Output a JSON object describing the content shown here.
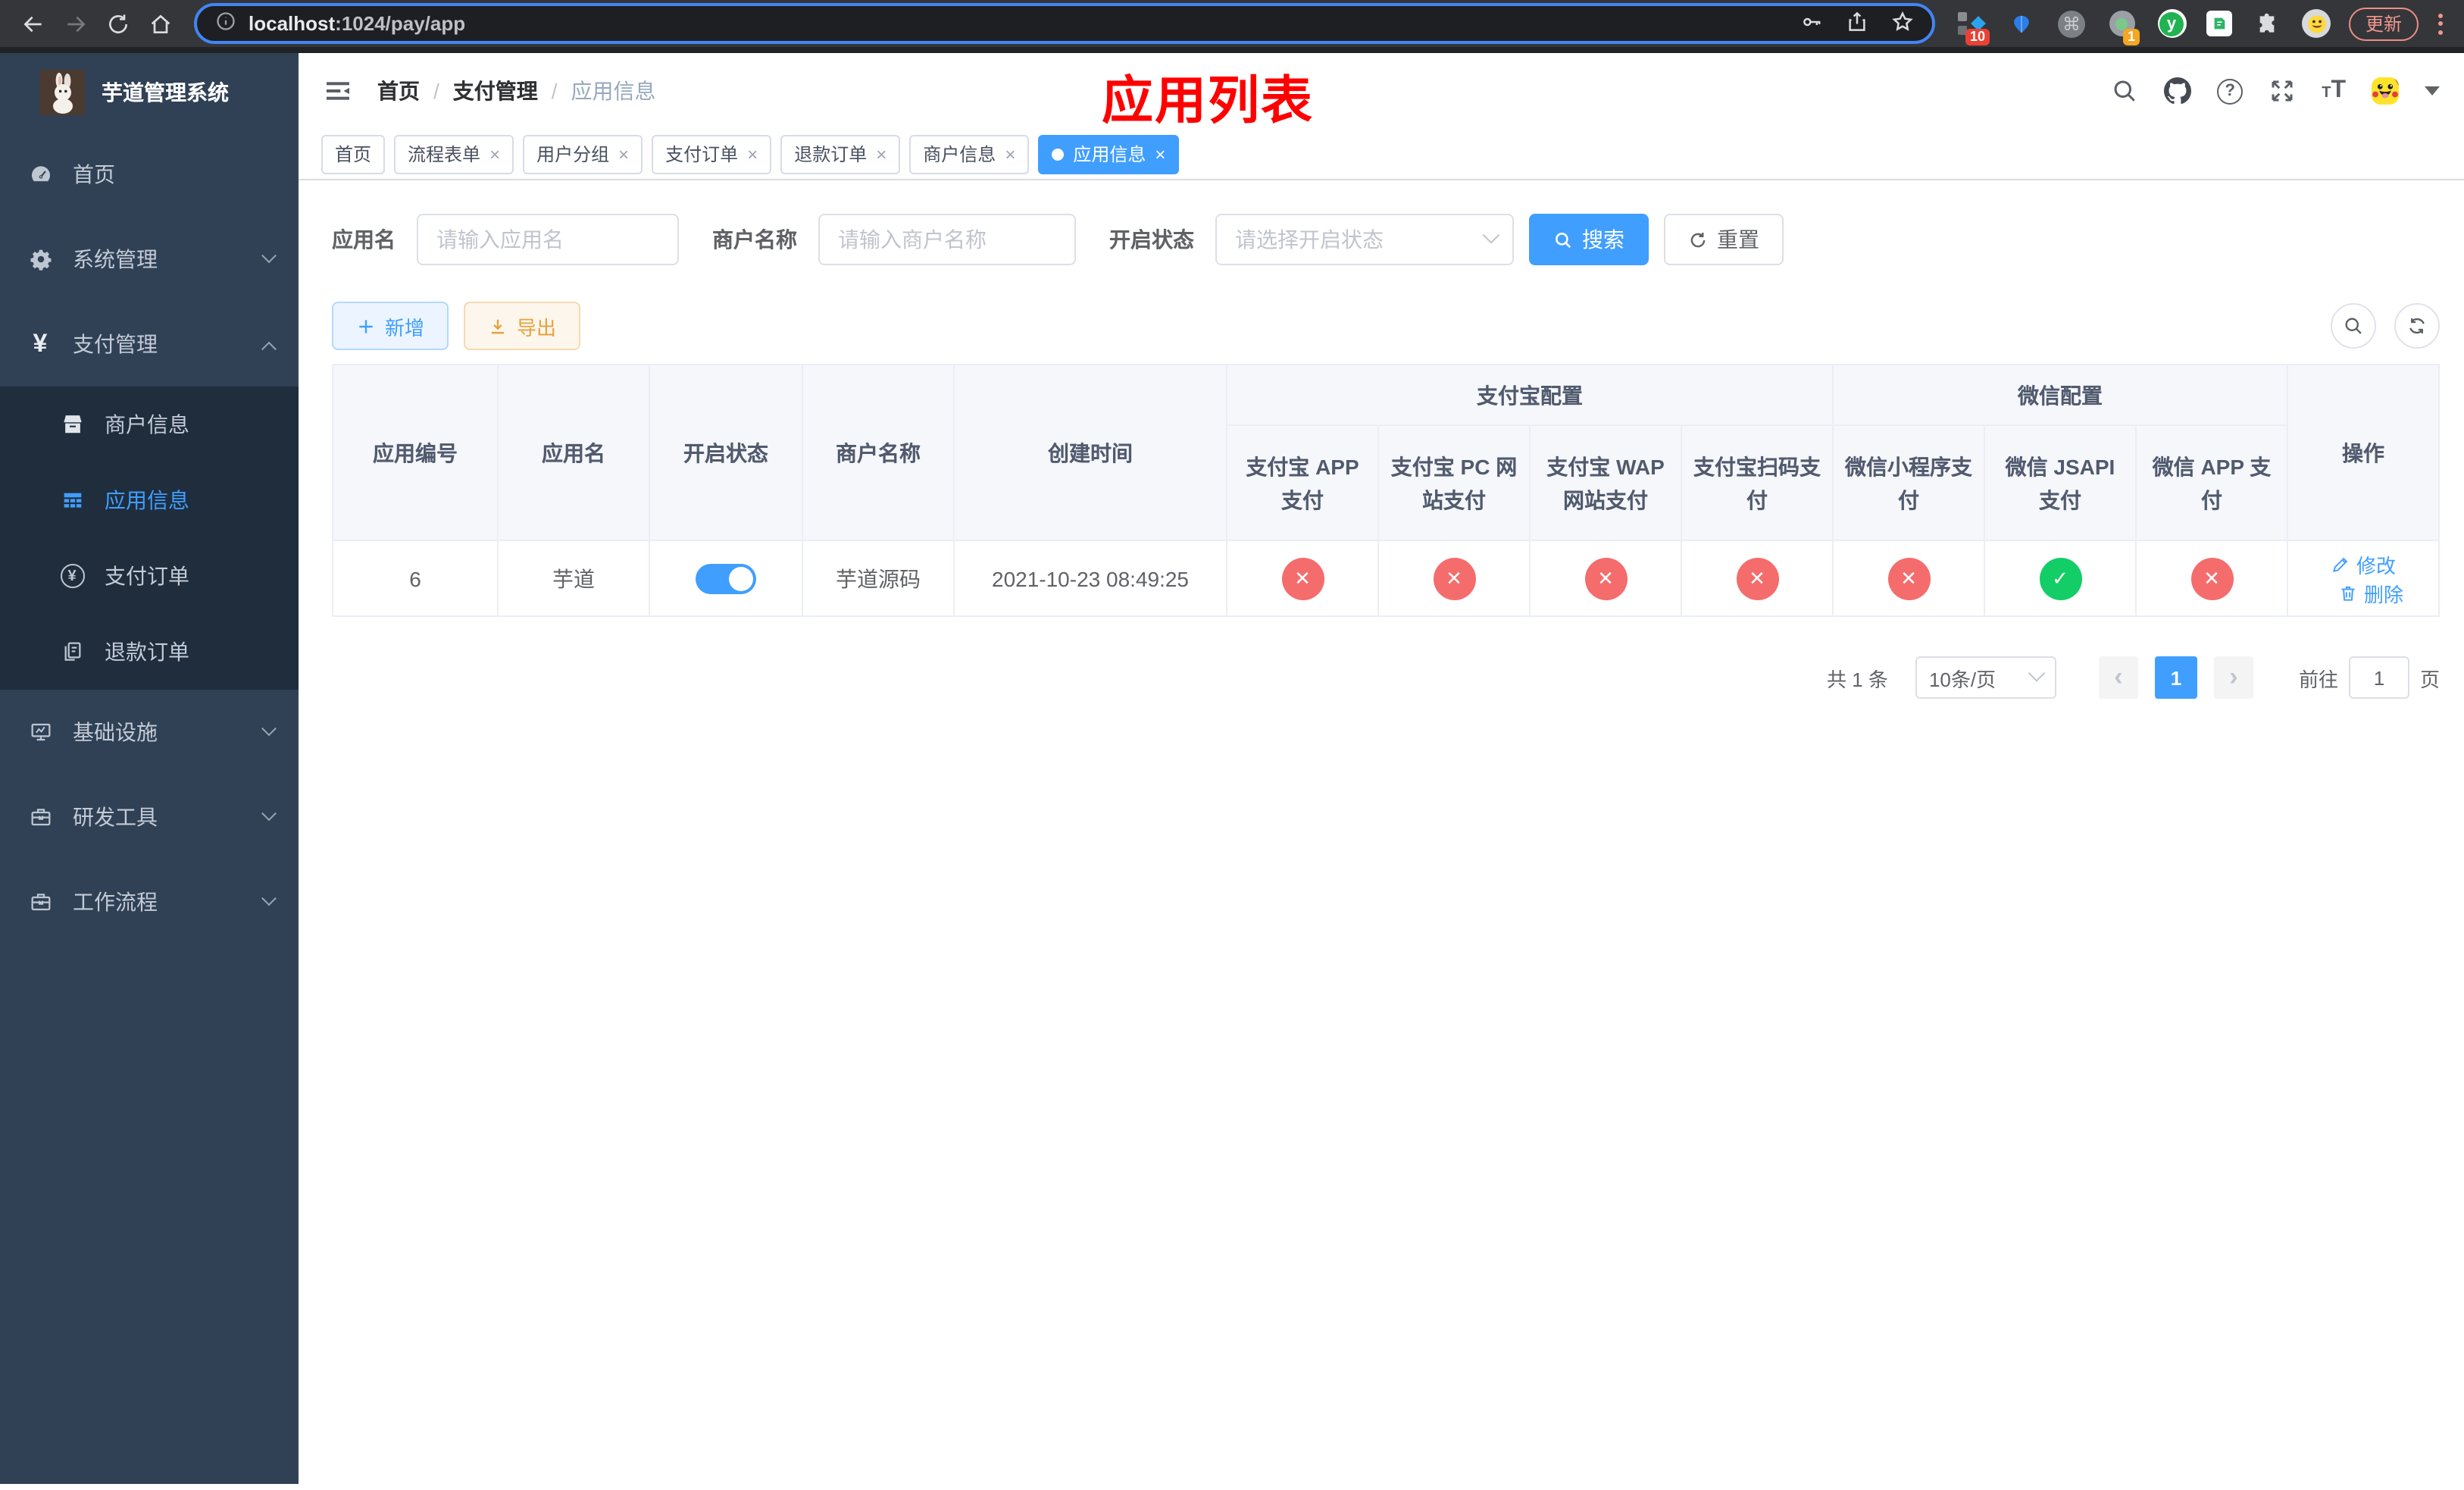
{
  "browser": {
    "url": {
      "host": "localhost",
      "path": ":1024/pay/app"
    },
    "update_label": "更新",
    "ext_badges": {
      "first": "10",
      "second": "1"
    }
  },
  "sidebar": {
    "title": "芋道管理系统",
    "items": {
      "home": "首页",
      "system": "系统管理",
      "payment": "支付管理",
      "infra": "基础设施",
      "devtools": "研发工具",
      "workflow": "工作流程"
    },
    "submenu": {
      "merchant": "商户信息",
      "app": "应用信息",
      "pay_order": "支付订单",
      "refund_order": "退款订单"
    }
  },
  "navbar": {
    "breadcrumb": {
      "l1": "首页",
      "l2": "支付管理",
      "l3": "应用信息",
      "separator": "/"
    },
    "annotation": "应用列表"
  },
  "tags": [
    {
      "label": "首页",
      "closable": false,
      "active": false
    },
    {
      "label": "流程表单",
      "closable": true,
      "active": false
    },
    {
      "label": "用户分组",
      "closable": true,
      "active": false
    },
    {
      "label": "支付订单",
      "closable": true,
      "active": false
    },
    {
      "label": "退款订单",
      "closable": true,
      "active": false
    },
    {
      "label": "商户信息",
      "closable": true,
      "active": false
    },
    {
      "label": "应用信息",
      "closable": true,
      "active": true
    }
  ],
  "filters": {
    "app_name_label": "应用名",
    "app_name_placeholder": "请输入应用名",
    "merchant_label": "商户名称",
    "merchant_placeholder": "请输入商户名称",
    "status_label": "开启状态",
    "status_placeholder": "请选择开启状态",
    "search_label": "搜索",
    "reset_label": "重置"
  },
  "toolbar": {
    "add_label": "新增",
    "export_label": "导出"
  },
  "table": {
    "groups": {
      "alipay": "支付宝配置",
      "wechat": "微信配置"
    },
    "columns": {
      "app_id": "应用编号",
      "app_name": "应用名",
      "status": "开启状态",
      "merchant": "商户名称",
      "created": "创建时间",
      "alipay_app": "支付宝 APP 支付",
      "alipay_pc": "支付宝 PC 网站支付",
      "alipay_wap": "支付宝 WAP 网站支付",
      "alipay_qr": "支付宝扫码支付",
      "wx_mini": "微信小程序支付",
      "wx_jsapi": "微信 JSAPI 支付",
      "wx_app": "微信 APP 支付",
      "actions": "操作"
    },
    "row": {
      "app_id": "6",
      "app_name": "芋道",
      "enabled": true,
      "merchant": "芋道源码",
      "created": "2021-10-23 08:49:25",
      "channels": {
        "alipay_app": false,
        "alipay_pc": false,
        "alipay_wap": false,
        "alipay_qr": false,
        "wx_mini": false,
        "wx_jsapi": true,
        "wx_app": false
      },
      "edit_label": "修改",
      "delete_label": "删除"
    }
  },
  "pagination": {
    "total": "共 1 条",
    "page_size": "10条/页",
    "page": "1",
    "goto_prefix": "前往",
    "goto_value": "1",
    "goto_suffix": "页"
  },
  "icons": {
    "cross": "✕",
    "check": "✓",
    "close": "×",
    "prev": "‹",
    "next": "›"
  },
  "colors": {
    "accent": "#409eff",
    "danger": "#f56c6c",
    "success": "#13ce66",
    "warning": "#e6a23c",
    "annotation": "#ff0000",
    "sidebar_bg": "#304156",
    "submenu_bg": "#1f2d3d",
    "header_bg": "#f5f7fa"
  }
}
